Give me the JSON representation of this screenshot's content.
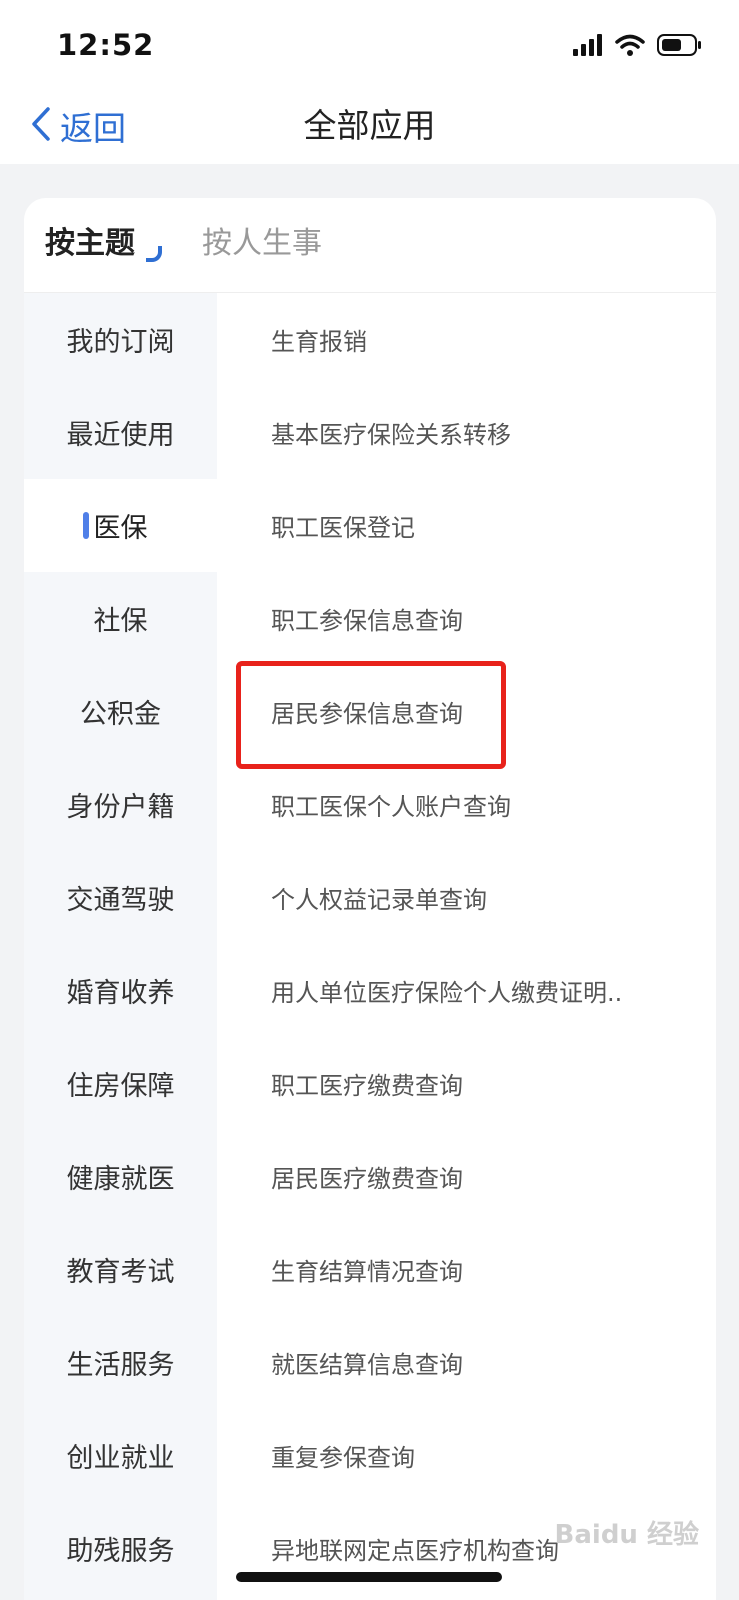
{
  "status_bar": {
    "time": "12:52",
    "icons": [
      "signal-icon",
      "wifi-icon",
      "battery-icon"
    ]
  },
  "nav": {
    "back_label": "返回",
    "title": "全部应用"
  },
  "tabs": {
    "active": "按主题",
    "inactive": "按人生事"
  },
  "sidebar": {
    "items": [
      {
        "label": "我的订阅"
      },
      {
        "label": "最近使用"
      },
      {
        "label": "医保",
        "selected": true
      },
      {
        "label": "社保"
      },
      {
        "label": "公积金"
      },
      {
        "label": "身份户籍"
      },
      {
        "label": "交通驾驶"
      },
      {
        "label": "婚育收养"
      },
      {
        "label": "住房保障"
      },
      {
        "label": "健康就医"
      },
      {
        "label": "教育考试"
      },
      {
        "label": "生活服务"
      },
      {
        "label": "创业就业"
      },
      {
        "label": "助残服务"
      }
    ]
  },
  "services": {
    "items": [
      {
        "label": "生育报销"
      },
      {
        "label": "基本医疗保险关系转移"
      },
      {
        "label": "职工医保登记"
      },
      {
        "label": "职工参保信息查询"
      },
      {
        "label": "居民参保信息查询",
        "highlighted": true
      },
      {
        "label": "职工医保个人账户查询"
      },
      {
        "label": "个人权益记录单查询"
      },
      {
        "label": "用人单位医疗保险个人缴费证明.."
      },
      {
        "label": "职工医疗缴费查询"
      },
      {
        "label": "居民医疗缴费查询"
      },
      {
        "label": "生育结算情况查询"
      },
      {
        "label": "就医结算信息查询"
      },
      {
        "label": "重复参保查询"
      },
      {
        "label": "异地联网定点医疗机构查询"
      }
    ]
  },
  "watermark": "Baidu 经验",
  "colors": {
    "accent": "#2f6fd3",
    "selected_bar": "#4f7fe8",
    "highlight": "#e8221b",
    "sidebar_bg": "#f5f7fa",
    "page_bg": "#f2f3f5"
  }
}
